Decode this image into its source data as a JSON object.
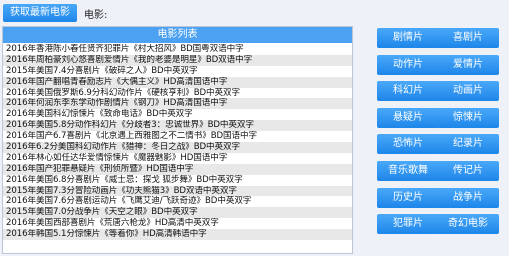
{
  "toolbar": {
    "fetch_label": "获取最新电影",
    "movie_label": "电影:"
  },
  "list": {
    "header": "电影列表",
    "rows": [
      "2016年香港陈小春任贤齐犯罪片《村大招风》BD国粤双语中字",
      "2016年周柏豪刘心悠喜剧爱情片《我的老婆是明星》BD双语中字",
      "2015年美国7.4分喜剧片《破碎之人》BD中英双字",
      "2016年国产翻唱青春励志片《大偶主义》HD高清国语中字",
      "2016年美国俄罗斯6.9分科幻动作片《硬核亨利》BD中英双字",
      "2016年何润东李东学动作剧情片《钢刀》HD高清国语中字",
      "2016年美国科幻惊悚片《致命电话》BD中英双字",
      "2016年美国5.8分动作科幻片《分歧者3：忠诚世界》BD中英双字",
      "2016年国产6.7喜剧片《北京遇上西雅图之不二情书》BD国语中字",
      "2016年6.2分美国科幻动作片《猎神：冬日之战》BD中英双字",
      "2016年林心如任达华爱情惊悚片《魔器魅影》HD国语中字",
      "2016年国产犯罪悬疑片《刑侦所暨》HD国语中字",
      "2016年美国6.8分喜剧片《威士忌：探戈 狐步舞》BD中英双字",
      "2015年美国7.3分冒险动画片《功夫熊猫3》BD双语中英双字",
      "2016年美国7.6分喜剧运动片《飞鹰艾迪/飞跃奇迹》BD中英双字",
      "2015年美国7.0分战争片《天空之眼》BD中英双字",
      "2016年美国西部喜剧片《荒唐六枪龙》HD高清中英双字",
      "2016年韩国5.1分惊悚片《等着你》HD高清韩语中字"
    ]
  },
  "genres": [
    "剧情片",
    "喜剧片",
    "动作片",
    "爱情片",
    "科幻片",
    "动画片",
    "悬疑片",
    "惊悚片",
    "恐怖片",
    "纪录片",
    "音乐歌舞",
    "传记片",
    "历史片",
    "战争片",
    "犯罪片",
    "奇幻电影"
  ]
}
